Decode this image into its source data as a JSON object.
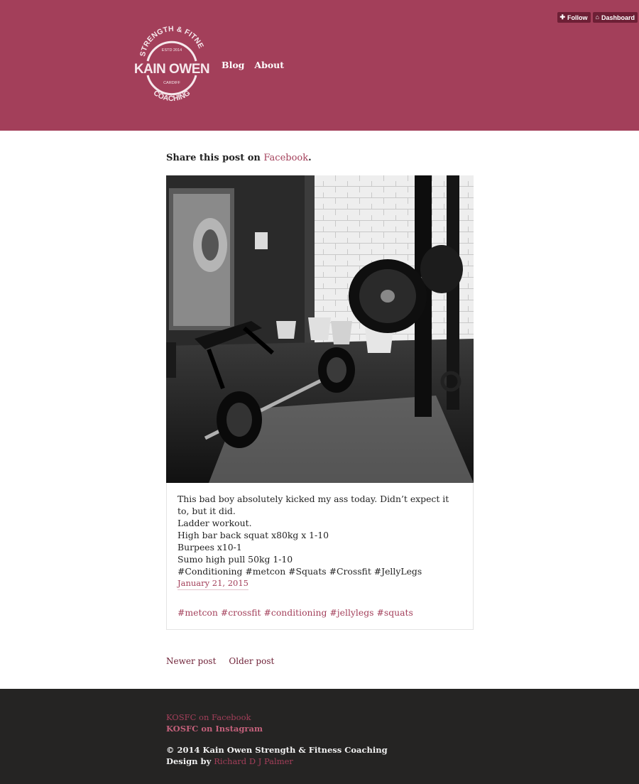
{
  "colors": {
    "brand": "#a33f5a",
    "brand_dark": "#6d1f35",
    "footer_bg": "#252423"
  },
  "logo": {
    "top_arc": "STRENGTH & FITNESS",
    "estd": "ESTD 2014",
    "name": "KAIN OWEN",
    "city": "CARDIFF",
    "bottom_arc": "COACHING",
    "icon": "kain-owen-logo"
  },
  "nav": {
    "items": [
      {
        "label": "Blog"
      },
      {
        "label": "About"
      }
    ]
  },
  "toolbar": {
    "follow_label": "Follow",
    "follow_icon": "plus-icon",
    "dashboard_label": "Dashboard",
    "dashboard_icon": "home-icon"
  },
  "share": {
    "prefix": "Share this post on ",
    "link": "Facebook",
    "suffix": "."
  },
  "post": {
    "caption_lines": [
      "This bad boy absolutely kicked my ass today. Didn’t expect it to, but it did.",
      "Ladder workout.",
      "High bar back squat x80kg x 1-10",
      "Burpees x10-1",
      "Sumo high pull 50kg 1-10",
      "#Conditioning #metcon #Squats #Crossfit #JellyLegs"
    ],
    "date": "January 21, 2015",
    "tags": [
      "#metcon",
      "#crossfit",
      "#conditioning",
      "#jellylegs",
      "#squats"
    ]
  },
  "pagination": {
    "newer": "Newer post",
    "older": "Older post"
  },
  "footer": {
    "facebook": "KOSFC on Facebook",
    "instagram": "KOSFC on Instagram",
    "copyright": "© 2014 Kain Owen Strength & Fitness Coaching",
    "design_prefix": "Design by ",
    "designer": "Richard D J Palmer"
  }
}
